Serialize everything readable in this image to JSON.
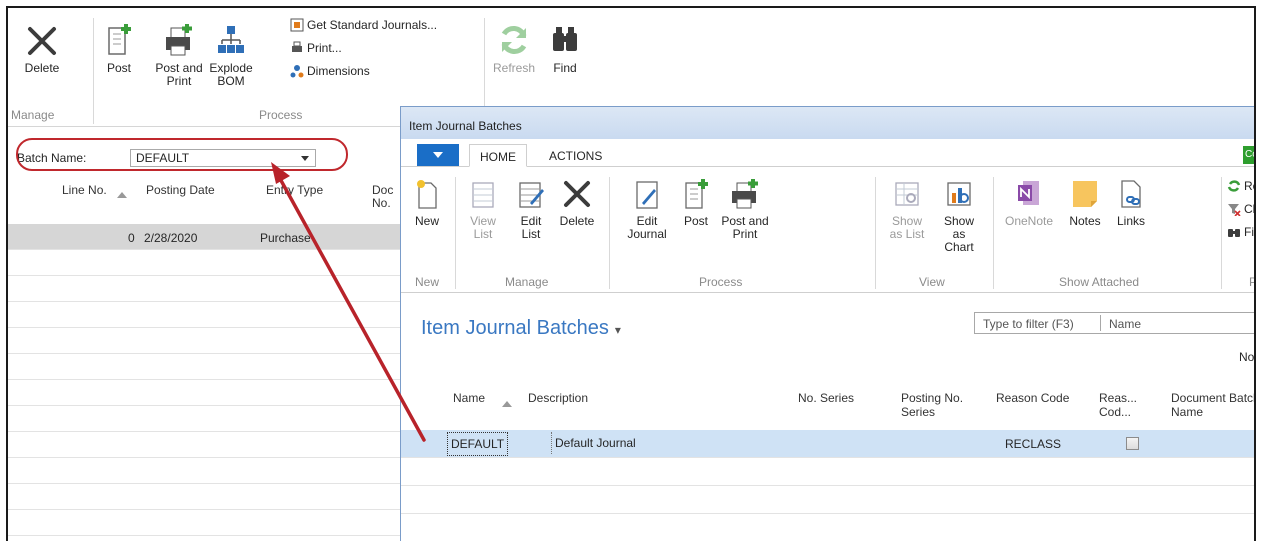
{
  "back_ribbon": {
    "delete": "Delete",
    "post": "Post",
    "post_and_print": "Post and Print",
    "explode_bom": "Explode BOM",
    "get_standard_journals": "Get Standard Journals...",
    "print": "Print...",
    "dimensions": "Dimensions",
    "refresh": "Refresh",
    "find": "Find",
    "group_manage": "Manage",
    "group_process": "Process"
  },
  "batch": {
    "label": "Batch Name:",
    "value": "DEFAULT"
  },
  "back_grid": {
    "columns": [
      "Line No.",
      "Posting Date",
      "Entry Type",
      "Doc No."
    ],
    "rows": [
      {
        "line_no": "0",
        "posting_date": "2/28/2020",
        "entry_type": "Purchase"
      }
    ]
  },
  "dialog": {
    "title": "Item Journal Batches",
    "tabs": [
      "HOME",
      "ACTIONS"
    ],
    "ribbon": {
      "new": "New",
      "view_list": "View List",
      "edit_list": "Edit List",
      "delete": "Delete",
      "edit_journal": "Edit Journal",
      "post": "Post",
      "post_and_print": "Post and Print",
      "show_as_list": "Show as List",
      "show_as_chart": "Show as Chart",
      "onenote": "OneNote",
      "notes": "Notes",
      "links": "Links",
      "re": "Re",
      "cl": "Cl",
      "fi": "Fi",
      "group_new": "New",
      "group_manage": "Manage",
      "group_process": "Process",
      "group_view": "View",
      "group_show_attached": "Show Attached",
      "group_p": "P",
      "corner": "Co"
    },
    "page_title": "Item Journal Batches",
    "filter_placeholder": "Type to filter (F3)",
    "filter_field": "Name",
    "no_label": "No",
    "columns": {
      "name": "Name",
      "description": "Description",
      "no_series": "No. Series",
      "posting_no_series": "Posting No. Series",
      "reason_code": "Reason Code",
      "reas_cod": "Reas... Cod...",
      "document_batch_name": "Document Batch Name"
    },
    "rows": [
      {
        "name": "DEFAULT",
        "description": "Default Journal",
        "reason_code": "RECLASS"
      }
    ]
  },
  "colors": {
    "accent_blue": "#3a78c2",
    "highlight_red": "#c0282d",
    "selected_row": "#cfe2f5"
  }
}
